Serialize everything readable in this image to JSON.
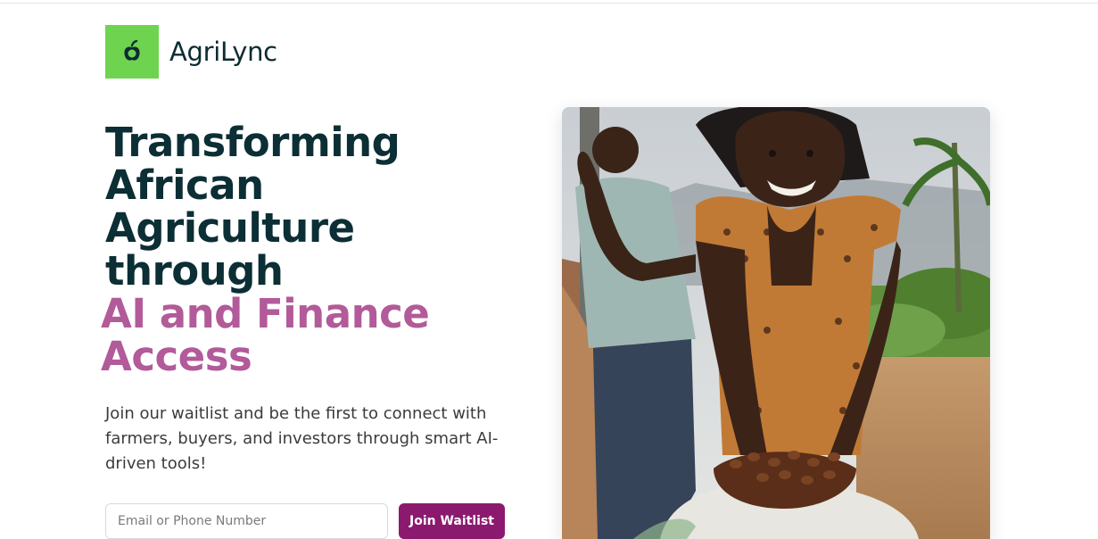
{
  "brand": {
    "name": "AgriLync",
    "logo_icon": "apple-icon",
    "logo_color": "#6ed44f"
  },
  "hero": {
    "headline_lines": [
      "Transforming",
      "African",
      "Agriculture",
      "through"
    ],
    "accent_lines": [
      "AI and Finance",
      "Access"
    ],
    "subtext": "Join our waitlist and be the first to connect with farmers, buyers, and investors through smart AI-driven tools!",
    "accent_color": "#b25a9a"
  },
  "waitlist": {
    "placeholder": "Email or Phone Number",
    "button_label": "Join Waitlist",
    "button_color": "#8b1a6e"
  }
}
